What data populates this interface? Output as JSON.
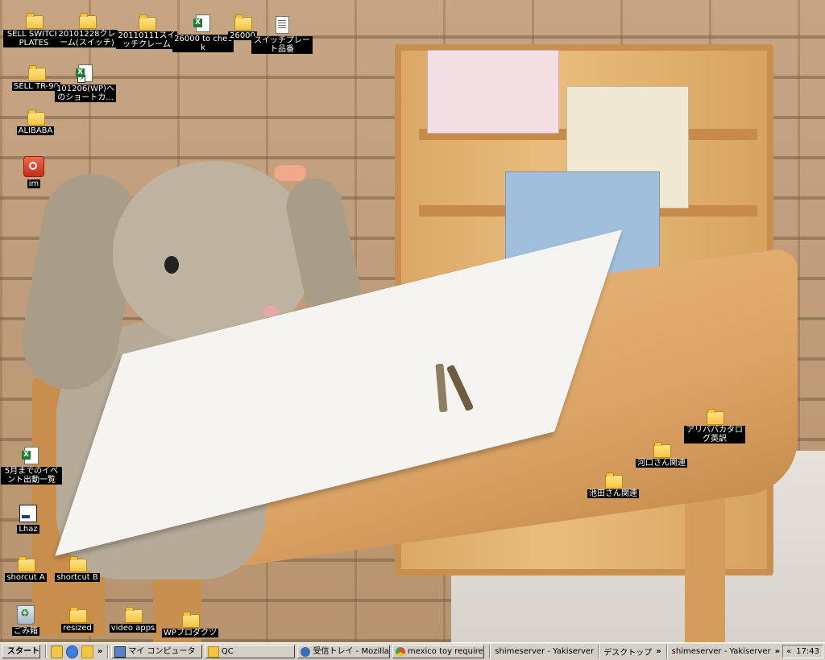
{
  "desktop": {
    "icons": {
      "sell_switch_plates": "SELL SWITCH PLATES",
      "folder_20101228": "20101228クレーム(スイッチ)",
      "folder_20110111": "20110111スイッチクレーム",
      "xls_26000_to_check": "26000 to check",
      "folder_26000": "26000",
      "doc_switch_plate": "スイッチプレート品番",
      "sell_tr90": "SELL TR-90",
      "xls_101206": "101206(WP)へのショートカ...",
      "alibaba": "ALIBABA",
      "im": "im",
      "xls_may_events": "5月までのイベント出動一覧",
      "lhaz": "Lhaz",
      "shortcut_a": "shorcut A",
      "shortcut_b": "shortcut B",
      "recycle_bin": "ごみ箱",
      "resized": "resized",
      "video_apps": "video apps",
      "wp_products": "WPプロダクツ",
      "ikeda": "池田さん関連",
      "kawaguchi": "河口さん関連",
      "alibaba_catalog": "アリババカタログ英訳"
    }
  },
  "taskbar": {
    "start": "スタート",
    "quicklaunch_more": "»",
    "tasks": {
      "my_computer": "マイ コンピュータ",
      "qc": "QC",
      "inbox": "受信トレイ - Mozilla Thu...",
      "chrome": "mexico toy requirement ..."
    },
    "toolbars": {
      "shimeserver1": "shimeserver - Yakiserver",
      "desktop": "デスクトップ",
      "shimeserver2": "shimeserver - Yakiserver"
    },
    "more": "»",
    "tray_collapse": "«",
    "clock": "17:43"
  }
}
